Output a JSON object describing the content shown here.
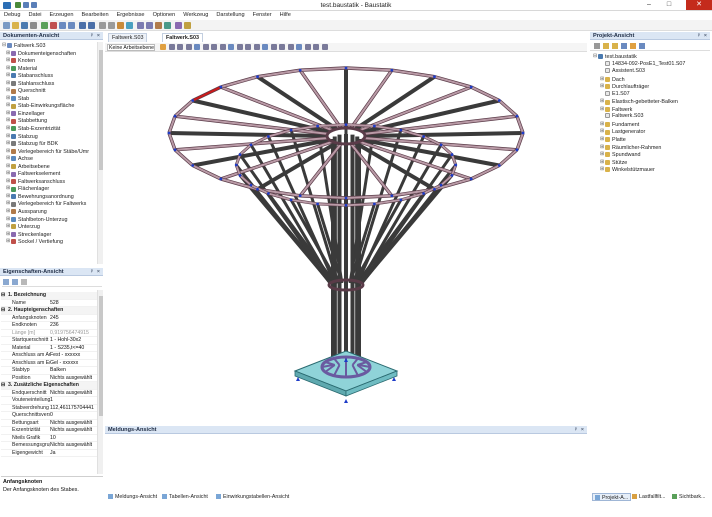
{
  "window": {
    "title": "test.baustatik - Baustatik"
  },
  "menu": [
    "Debug",
    "Datei",
    "Erzeugen",
    "Bearbeiten",
    "Ergebnisse",
    "Optionen",
    "Werkzeug",
    "Darstellung",
    "Fenster",
    "Hilfe"
  ],
  "doc_panel": {
    "title": "Dokumenten-Ansicht",
    "root": "Faltwerk.S03",
    "items": [
      "Dokumenteigenschaften",
      "Knoten",
      "Material",
      "Stabanschluss",
      "Stahlanschluss",
      "Querschnitt",
      "Stab",
      "Stab-Einwirkungsfläche",
      "Einzellager",
      "Stabbettung",
      "Stab-Exzentrizität",
      "Stabzug",
      "Stabzug für BDK",
      "Verlegebereich für Stäbe/Umr",
      "Achse",
      "Arbeitsebene",
      "Faltwerkselement",
      "Faltwerksanschluss",
      "Flächenlager",
      "Bewehrungsanordnung",
      "Verlegebereich für Faltwerks",
      "Aussparung",
      "Stahlbeton-Unterzug",
      "Unterzug",
      "Streckenlager",
      "Sockel / Vertiefung"
    ]
  },
  "props_panel": {
    "title": "Eigenschaften-Ansicht",
    "rows": [
      {
        "t": "sec",
        "k": "1. Bezeichnung"
      },
      {
        "k": "Name",
        "v": "528"
      },
      {
        "t": "sec",
        "k": "2. Haupteigenschaften"
      },
      {
        "k": "Anfangsknoten",
        "v": "245"
      },
      {
        "k": "Endknoten",
        "v": "236"
      },
      {
        "t": "dis",
        "k": "Länge [m]",
        "v": "0,919756474915"
      },
      {
        "k": "Startquerschnitt",
        "v": "1 - Hohl-30x2"
      },
      {
        "k": "Material",
        "v": "1 - S235,t<=40"
      },
      {
        "k": "Anschluss am Anfang",
        "v": "Fest - xxxxxx"
      },
      {
        "k": "Anschluss am Ende",
        "v": "Gel - xxxxxx"
      },
      {
        "k": "Stabtyp",
        "v": "Balken"
      },
      {
        "k": "Position",
        "v": "Nichts ausgewählt"
      },
      {
        "t": "sec",
        "k": "3. Zusätzliche Eigenschaften"
      },
      {
        "k": "Endquerschnitt",
        "v": "Nichts ausgewählt"
      },
      {
        "k": "Vouteneinteilung",
        "v": "1"
      },
      {
        "k": "Stabverdrehung",
        "v": "112,461175704441"
      },
      {
        "k": "Querschnittsversatz",
        "v": "0"
      },
      {
        "k": "Bettungsart",
        "v": "Nichts ausgewählt"
      },
      {
        "k": "Exzentrizität",
        "v": "Nichts ausgewählt"
      },
      {
        "k": "Nteils Grafik",
        "v": "10"
      },
      {
        "k": "Bemessungsgruppe",
        "v": "Nichts ausgewählt"
      },
      {
        "k": "Eigengewicht",
        "v": "Ja"
      }
    ],
    "help_title": "Anfangsknoten",
    "help_text": "Der Anfangsknoten des Stabes."
  },
  "doc_tabs": [
    {
      "label": "Faltwerk.S03",
      "active": false
    },
    {
      "label": "Faltwerk.S03",
      "active": true
    }
  ],
  "view_toolbar": {
    "workplane": "Keine Arbeitsebene"
  },
  "messages": {
    "title": "Meldungs-Ansicht"
  },
  "bottom_tabs": [
    "Meldungs-Ansicht",
    "Tabellen-Ansicht",
    "Einwirkungstabellen-Ansicht"
  ],
  "project_panel": {
    "title": "Projekt-Ansicht",
    "root": "test.baustatik",
    "items": [
      "14834-092-PosE1_Test01.S07",
      "Assistent.S03",
      "Dach",
      "Durchlaufträger",
      "E1.S07",
      "Elastisch-gebetteter-Balken",
      "Faltwerk",
      "Faltwerk.S03",
      "Fundament",
      "Lastgenerator",
      "Platte",
      "Räumlicher-Rahmen",
      "Spundwand",
      "Stütze",
      "Winkelstützmauer"
    ]
  },
  "status_right": [
    "Projekt-A...",
    "Lastfallfilt...",
    "Sichtbark..."
  ],
  "colors": {
    "member": "#b99aa6",
    "member_outline": "#5a3b48",
    "column": "#3a3a3a",
    "selected": "#cc1a1a",
    "base": "#8fd3d8",
    "node": "#1e3cc8"
  }
}
